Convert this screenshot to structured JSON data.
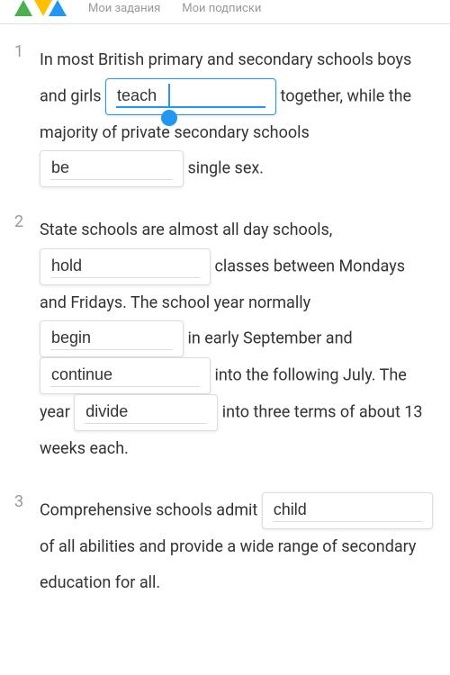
{
  "header": {
    "nav1": "Мои задания",
    "nav2": "Мои подписки"
  },
  "questions": [
    {
      "num": "1",
      "parts": [
        "In most British primary and secondary schools boys and girls",
        "together, while the majority of private secondary schools",
        "single sex."
      ],
      "blanks": [
        "teach",
        "be"
      ]
    },
    {
      "num": "2",
      "parts": [
        "State schools are almost all day schools,",
        "classes between Mondays and Fridays. The school year normally",
        "in early September and",
        "into the following July. The year",
        "into three terms of about 13 weeks each."
      ],
      "blanks": [
        "hold",
        "begin",
        "continue",
        "divide"
      ]
    },
    {
      "num": "3",
      "parts": [
        "Comprehensive schools admit",
        "of all abilities and provide a wide range of secondary education for all."
      ],
      "blanks": [
        "child"
      ]
    }
  ]
}
